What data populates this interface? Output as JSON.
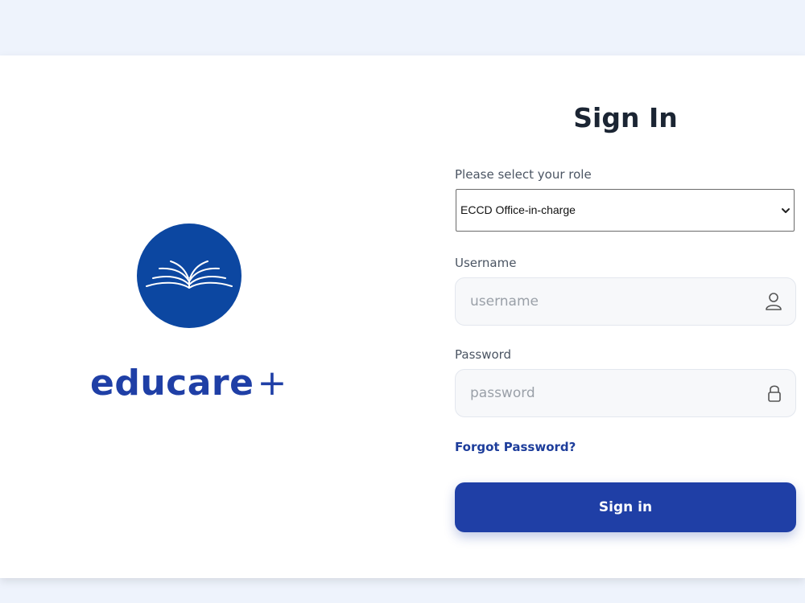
{
  "brand": {
    "name": "educare",
    "plus": "+",
    "logo_icon": "open-book-icon",
    "logo_color": "#0c47a1",
    "text_color": "#1f3fa6"
  },
  "form": {
    "title": "Sign In",
    "role_label": "Please select your role",
    "role_selected": "ECCD Office-in-charge",
    "username_label": "Username",
    "username_placeholder": "username",
    "username_icon": "user-icon",
    "password_label": "Password",
    "password_placeholder": "password",
    "password_icon": "lock-icon",
    "forgot_link": "Forgot Password?",
    "submit_label": "Sign in",
    "accent_color": "#1f3fa6"
  }
}
